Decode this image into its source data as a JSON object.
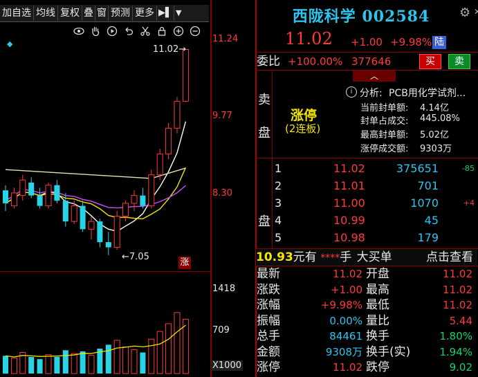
{
  "toolbar": {
    "items": [
      "加自选",
      "均线",
      "复权",
      "叠",
      "窗",
      "预测",
      "更多"
    ],
    "icons": [
      "eye-icon",
      "hand-icon",
      "play-icon",
      "undo-icon",
      "scissors-icon",
      "lock-icon",
      "zoom-in-icon",
      "zoom-out-icon"
    ]
  },
  "chart": {
    "price_ticks": [
      "11.24",
      "9.77",
      "8.30"
    ],
    "volume_ticks": [
      "1418",
      "709"
    ],
    "volume_unit": "X1000",
    "high_label": "11.02→",
    "low_label": "←7.05",
    "limit_tag": "涨",
    "colors": {
      "up": "#ff3b3b",
      "down": "#29d3e6",
      "ma5": "#ffffff",
      "ma10": "#f2e600",
      "ma20": "#d24cff",
      "ma60": "#11d36b"
    },
    "candles": [
      {
        "o": 8.3,
        "h": 8.4,
        "l": 7.9,
        "c": 8.05
      },
      {
        "o": 8.0,
        "h": 8.35,
        "l": 7.95,
        "c": 8.25
      },
      {
        "o": 8.2,
        "h": 8.6,
        "l": 8.1,
        "c": 8.5
      },
      {
        "o": 8.45,
        "h": 8.55,
        "l": 8.15,
        "c": 8.2
      },
      {
        "o": 8.2,
        "h": 8.35,
        "l": 7.95,
        "c": 8.0
      },
      {
        "o": 8.0,
        "h": 8.45,
        "l": 7.95,
        "c": 8.4
      },
      {
        "o": 8.4,
        "h": 8.5,
        "l": 8.05,
        "c": 8.1
      },
      {
        "o": 8.1,
        "h": 8.25,
        "l": 7.6,
        "c": 7.7
      },
      {
        "o": 7.7,
        "h": 8.1,
        "l": 7.65,
        "c": 8.0
      },
      {
        "o": 8.0,
        "h": 8.1,
        "l": 7.5,
        "c": 7.55
      },
      {
        "o": 7.55,
        "h": 7.8,
        "l": 7.35,
        "c": 7.7
      },
      {
        "o": 7.7,
        "h": 7.75,
        "l": 7.2,
        "c": 7.3
      },
      {
        "o": 7.3,
        "h": 7.5,
        "l": 7.05,
        "c": 7.2
      },
      {
        "o": 7.2,
        "h": 7.9,
        "l": 7.15,
        "c": 7.8
      },
      {
        "o": 7.8,
        "h": 8.1,
        "l": 7.7,
        "c": 8.05
      },
      {
        "o": 8.05,
        "h": 8.3,
        "l": 7.9,
        "c": 8.2
      },
      {
        "o": 8.2,
        "h": 8.35,
        "l": 7.95,
        "c": 8.0
      },
      {
        "o": 8.0,
        "h": 8.7,
        "l": 7.95,
        "c": 8.6
      },
      {
        "o": 8.6,
        "h": 9.1,
        "l": 8.5,
        "c": 9.0
      },
      {
        "o": 9.0,
        "h": 9.6,
        "l": 8.9,
        "c": 9.5
      },
      {
        "o": 9.5,
        "h": 10.1,
        "l": 9.4,
        "c": 10.02
      },
      {
        "o": 10.02,
        "h": 11.02,
        "l": 10.0,
        "c": 11.02
      }
    ],
    "volumes": [
      320,
      280,
      380,
      300,
      260,
      340,
      300,
      420,
      360,
      400,
      330,
      450,
      520,
      600,
      480,
      430,
      380,
      620,
      760,
      900,
      1100,
      980
    ]
  },
  "quote": {
    "name": "西陇科学",
    "code": "002584",
    "price": "11.02",
    "change": "+1.00",
    "pct": "+9.98%",
    "badge": "陆",
    "webi_label": "委比",
    "webi_value": "+100.00%",
    "webi_volume": "377646",
    "buy_btn": "买",
    "sell_btn": "卖"
  },
  "sell": {
    "side_label_1": "卖",
    "side_label_2": "盘",
    "limit_status": "涨停",
    "limit_sub": "(2连板)",
    "analysis_label": "分析:",
    "analysis_text": "PCB用化学试剂...",
    "stats": [
      {
        "label": "当前封单额:",
        "value": "4.14亿"
      },
      {
        "label": "封单占成交:",
        "value": "445.08%"
      },
      {
        "label": "最高封单额:",
        "value": "5.02亿"
      },
      {
        "label": "涨停成交额:",
        "value": "9303万"
      }
    ]
  },
  "buy": {
    "side_label": "盘",
    "rows": [
      {
        "n": "1",
        "price": "11.02",
        "vol": "375651",
        "chg": "-85"
      },
      {
        "n": "2",
        "price": "11.01",
        "vol": "701",
        "chg": ""
      },
      {
        "n": "3",
        "price": "11.00",
        "vol": "1070",
        "chg": "+4"
      },
      {
        "n": "4",
        "price": "10.99",
        "vol": "45",
        "chg": ""
      },
      {
        "n": "5",
        "price": "10.98",
        "vol": "179",
        "chg": ""
      }
    ]
  },
  "bigorder": {
    "price": "10.93",
    "unit_text": "元有",
    "hidden": "****",
    "hand": "手",
    "label": "大买单",
    "link": "点击查看"
  },
  "stats": [
    {
      "l1": "最新",
      "v1": "11.02",
      "l2": "开盘",
      "v2": "11.02"
    },
    {
      "l1": "涨跌",
      "v1": "+1.00",
      "l2": "最高",
      "v2": "11.02"
    },
    {
      "l1": "涨幅",
      "v1": "+9.98%",
      "l2": "最低",
      "v2": "11.02"
    },
    {
      "l1": "振幅",
      "v1": "0.00%",
      "l2": "量比",
      "v2": "5.44"
    },
    {
      "l1": "总手",
      "v1": "84461",
      "l2": "换手",
      "v2": "1.80%"
    },
    {
      "l1": "金额",
      "v1": "9308万",
      "l2": "换手(实)",
      "v2": "1.94%"
    },
    {
      "l1": "涨停",
      "v1": "11.02",
      "l2": "跌停",
      "v2": "9.02"
    }
  ]
}
